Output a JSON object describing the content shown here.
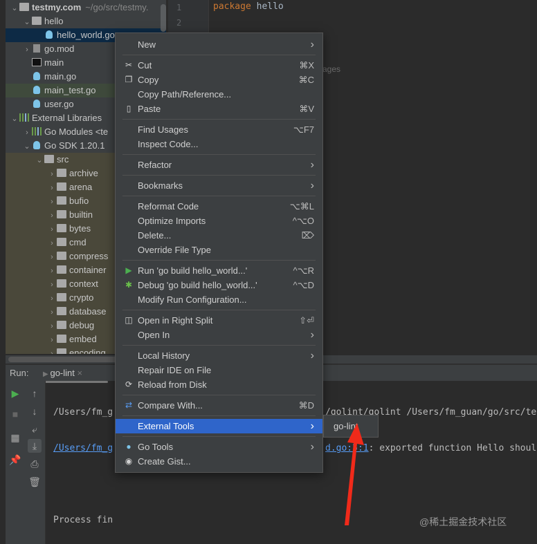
{
  "tree": [
    {
      "label": "testmy.com",
      "hint": "~/go/src/testmy.",
      "depth": 0,
      "chev": "open",
      "icon": "folder",
      "bold": true
    },
    {
      "label": "hello",
      "depth": 1,
      "chev": "open",
      "icon": "folder"
    },
    {
      "label": "hello_world.go",
      "depth": 2,
      "icon": "gopher",
      "state": "sel"
    },
    {
      "label": "go.mod",
      "depth": 1,
      "chev": "closed",
      "icon": "file"
    },
    {
      "label": "main",
      "depth": 1,
      "icon": "exec"
    },
    {
      "label": "main.go",
      "depth": 1,
      "icon": "gopher"
    },
    {
      "label": "main_test.go",
      "depth": 1,
      "icon": "gopher",
      "state": "test"
    },
    {
      "label": "user.go",
      "depth": 1,
      "icon": "gopher"
    },
    {
      "label": "External Libraries",
      "depth": 0,
      "chev": "open",
      "icon": "libs"
    },
    {
      "label": "Go Modules <te",
      "depth": 1,
      "chev": "closed",
      "icon": "libs"
    },
    {
      "label": "Go SDK 1.20.1",
      "depth": 1,
      "chev": "open",
      "icon": "gopher"
    },
    {
      "label": "src",
      "depth": 2,
      "chev": "open",
      "icon": "folder",
      "state": "lib"
    },
    {
      "label": "archive",
      "depth": 3,
      "chev": "closed",
      "icon": "folder",
      "state": "lib"
    },
    {
      "label": "arena",
      "depth": 3,
      "chev": "closed",
      "icon": "folder",
      "state": "lib"
    },
    {
      "label": "bufio",
      "depth": 3,
      "chev": "closed",
      "icon": "folder",
      "state": "lib"
    },
    {
      "label": "builtin",
      "depth": 3,
      "chev": "closed",
      "icon": "folder",
      "state": "lib"
    },
    {
      "label": "bytes",
      "depth": 3,
      "chev": "closed",
      "icon": "folder",
      "state": "lib"
    },
    {
      "label": "cmd",
      "depth": 3,
      "chev": "closed",
      "icon": "folder",
      "state": "lib"
    },
    {
      "label": "compress",
      "depth": 3,
      "chev": "closed",
      "icon": "folder",
      "state": "lib"
    },
    {
      "label": "container",
      "depth": 3,
      "chev": "closed",
      "icon": "folder",
      "state": "lib"
    },
    {
      "label": "context",
      "depth": 3,
      "chev": "closed",
      "icon": "folder",
      "state": "lib"
    },
    {
      "label": "crypto",
      "depth": 3,
      "chev": "closed",
      "icon": "folder",
      "state": "lib"
    },
    {
      "label": "database",
      "depth": 3,
      "chev": "closed",
      "icon": "folder",
      "state": "lib"
    },
    {
      "label": "debug",
      "depth": 3,
      "chev": "closed",
      "icon": "folder",
      "state": "lib"
    },
    {
      "label": "embed",
      "depth": 3,
      "chev": "closed",
      "icon": "folder",
      "state": "lib"
    },
    {
      "label": "encoding",
      "depth": 3,
      "chev": "closed",
      "icon": "folder",
      "state": "lib"
    }
  ],
  "editor": {
    "line_numbers": [
      "1",
      "2"
    ],
    "keyword": "package",
    "name": "hello",
    "peek_text": "ages"
  },
  "run": {
    "label": "Run:",
    "tab": "go-lint",
    "lines": {
      "l1": "/Users/fm_g",
      "l1b": "/golint/golint /Users/fm_guan/go/src/te",
      "l2": "/Users/fm_g",
      "l2link": "d.go:5:1",
      "l2b": ": exported function Hello shoul",
      "l3": "Process fin"
    }
  },
  "menu": [
    {
      "label": "New",
      "submenu": true
    },
    {
      "sep": true
    },
    {
      "label": "Cut",
      "icon": "scissors-icon",
      "glyph": "✂",
      "shortcut": "⌘X"
    },
    {
      "label": "Copy",
      "icon": "copy-icon",
      "glyph": "❐",
      "shortcut": "⌘C"
    },
    {
      "label": "Copy Path/Reference..."
    },
    {
      "label": "Paste",
      "icon": "paste-icon",
      "glyph": "▯",
      "shortcut": "⌘V"
    },
    {
      "sep": true
    },
    {
      "label": "Find Usages",
      "shortcut": "⌥F7"
    },
    {
      "label": "Inspect Code..."
    },
    {
      "sep": true
    },
    {
      "label": "Refactor",
      "submenu": true
    },
    {
      "sep": true
    },
    {
      "label": "Bookmarks",
      "submenu": true
    },
    {
      "sep": true
    },
    {
      "label": "Reformat Code",
      "shortcut": "⌥⌘L"
    },
    {
      "label": "Optimize Imports",
      "shortcut": "^⌥O"
    },
    {
      "label": "Delete...",
      "shortcut": "⌦"
    },
    {
      "label": "Override File Type"
    },
    {
      "sep": true
    },
    {
      "label": "Run 'go build hello_world...'",
      "icon": "run-icon",
      "glyph": "▶",
      "color": "#4caf50",
      "shortcut": "^⌥R"
    },
    {
      "label": "Debug 'go build hello_world...'",
      "icon": "debug-icon",
      "glyph": "✱",
      "color": "#6abf4b",
      "shortcut": "^⌥D"
    },
    {
      "label": "Modify Run Configuration..."
    },
    {
      "sep": true
    },
    {
      "label": "Open in Right Split",
      "icon": "split-icon",
      "glyph": "◫",
      "shortcut": "⇧⏎"
    },
    {
      "label": "Open In",
      "submenu": true
    },
    {
      "sep": true
    },
    {
      "label": "Local History",
      "submenu": true
    },
    {
      "label": "Repair IDE on File"
    },
    {
      "label": "Reload from Disk",
      "icon": "reload-icon",
      "glyph": "⟳"
    },
    {
      "sep": true
    },
    {
      "label": "Compare With...",
      "icon": "compare-icon",
      "glyph": "⇄",
      "color": "#589df6",
      "shortcut": "⌘D"
    },
    {
      "sep": true
    },
    {
      "label": "External Tools",
      "submenu": true,
      "highlighted": true
    },
    {
      "sep": true
    },
    {
      "label": "Go Tools",
      "icon": "gopher-icon",
      "glyph": "●",
      "color": "#7dc4e8",
      "submenu": true
    },
    {
      "label": "Create Gist...",
      "icon": "github-icon",
      "glyph": "◉"
    }
  ],
  "submenu": {
    "item": "go-lint"
  },
  "annotation_color": "#f02a1a",
  "watermark": "@稀土掘金技术社区"
}
